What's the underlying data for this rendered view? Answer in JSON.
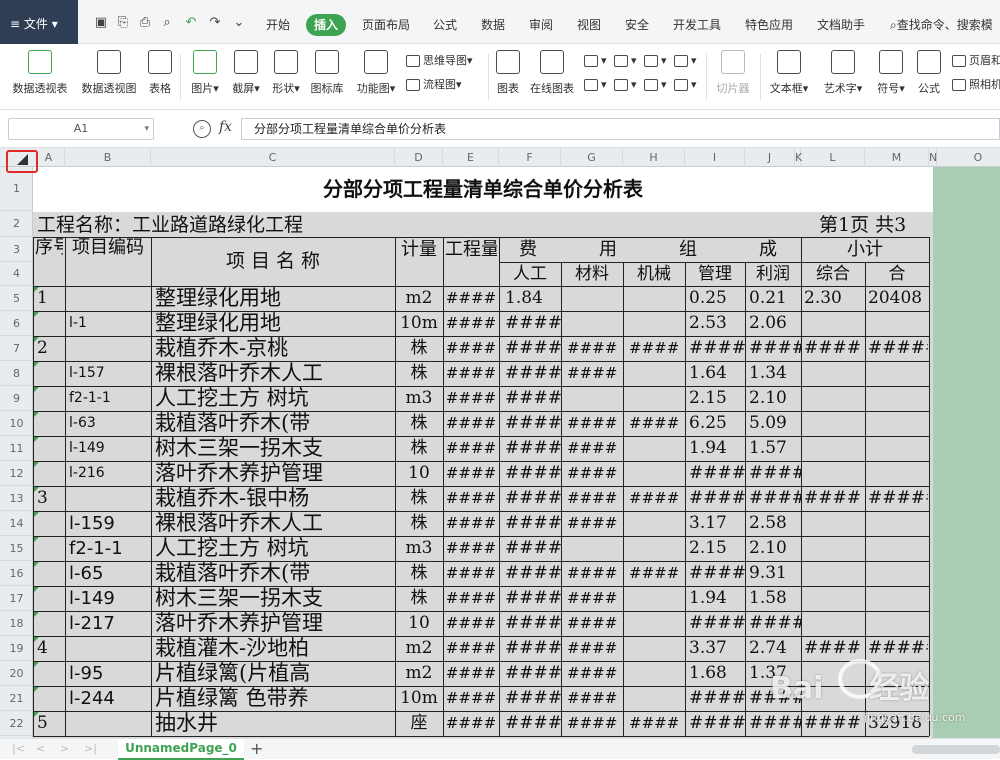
{
  "menubar": {
    "file": "文件",
    "tabs": [
      "开始",
      "插入",
      "页面布局",
      "公式",
      "数据",
      "审阅",
      "视图",
      "安全",
      "开发工具",
      "特色应用",
      "文档助手"
    ],
    "active_tab": "插入",
    "search": "查找命令、搜索模"
  },
  "ribbon": {
    "pivot_table": "数据透视表",
    "pivot_chart": "数据透视图",
    "table": "表格",
    "picture": "图片",
    "screenshot": "截屏",
    "shape": "形状",
    "icon_lib": "图标库",
    "func_chart": "功能图",
    "mindmap": "思维导图",
    "flowchart": "流程图",
    "chart": "图表",
    "online_chart": "在线图表",
    "slicer": "切片器",
    "textbox": "文本框",
    "wordart": "艺术字",
    "symbol": "符号",
    "formula": "公式",
    "header_footer": "页眉和",
    "camera": "照相机"
  },
  "formula_bar": {
    "name_box": "A1",
    "fx": "fx",
    "content": "分部分项工程量清单综合单价分析表"
  },
  "columns": [
    "A",
    "B",
    "C",
    "D",
    "E",
    "F",
    "G",
    "H",
    "I",
    "J",
    "K",
    "L",
    "M",
    "N",
    "O"
  ],
  "rows": [
    "1",
    "2",
    "3",
    "4",
    "5",
    "6",
    "7",
    "8",
    "9",
    "10",
    "11",
    "12",
    "13",
    "14",
    "15",
    "16",
    "17",
    "18",
    "19",
    "20",
    "21",
    "22"
  ],
  "sheet": {
    "title": "分部分项工程量清单综合单价分析表",
    "project": "工程名称：工业路道路绿化工程",
    "page": "第1页  共3",
    "headers": {
      "seq": "序号",
      "code": "项目编码",
      "name": "项 目 名 称",
      "unit": "计量",
      "qty": "工程量",
      "cost_group": [
        "费",
        "用",
        "组",
        "成"
      ],
      "labor": "人工",
      "material": "材料",
      "machine": "机械",
      "manage": "管理",
      "profit": "利润",
      "subtotal": "小计",
      "composite": "综合",
      "total": "合"
    },
    "rows": [
      {
        "a": "1",
        "b": "",
        "c": "整理绿化用地",
        "d": "m2",
        "e": "####",
        "f": "1.84",
        "g": "",
        "h": "",
        "i": "0.25",
        "j": "0.21",
        "l": "2.30",
        "m": "20408"
      },
      {
        "a": "",
        "b": "l-1",
        "c": "整理绿化用地",
        "d": "10m",
        "e": "####",
        "f": "####",
        "g": "",
        "h": "",
        "i": "2.53",
        "j": "2.06",
        "l": "",
        "m": ""
      },
      {
        "a": "2",
        "b": "",
        "c": "栽植乔木-京桃",
        "d": "株",
        "e": "####",
        "f": "####",
        "g": "####",
        "h": "####",
        "i": "####",
        "j": "####",
        "l": "####",
        "m": "#####"
      },
      {
        "a": "",
        "b": "l-157",
        "c": "裸根落叶乔木人工",
        "d": "株",
        "e": "####",
        "f": "####",
        "g": "####",
        "h": "",
        "i": "1.64",
        "j": "1.34",
        "l": "",
        "m": ""
      },
      {
        "a": "",
        "b": "f2-1-1",
        "c": "人工挖土方 树坑",
        "d": "m3",
        "e": "####",
        "f": "####",
        "g": "",
        "h": "",
        "i": "2.15",
        "j": "2.10",
        "l": "",
        "m": ""
      },
      {
        "a": "",
        "b": "l-63",
        "c": "栽植落叶乔木(带",
        "d": "株",
        "e": "####",
        "f": "####",
        "g": "####",
        "h": "####",
        "i": "6.25",
        "j": "5.09",
        "l": "",
        "m": ""
      },
      {
        "a": "",
        "b": "l-149",
        "c": "树木三架一拐木支",
        "d": "株",
        "e": "####",
        "f": "####",
        "g": "####",
        "h": "",
        "i": "1.94",
        "j": "1.57",
        "l": "",
        "m": ""
      },
      {
        "a": "",
        "b": "l-216",
        "c": "落叶乔木养护管理",
        "d": "10",
        "e": "####",
        "f": "####",
        "g": "####",
        "h": "",
        "i": "####",
        "j": "####",
        "l": "",
        "m": ""
      },
      {
        "a": "3",
        "b": "",
        "c": "栽植乔木-银中杨",
        "d": "株",
        "e": "####",
        "f": "####",
        "g": "####",
        "h": "####",
        "i": "####",
        "j": "####",
        "l": "####",
        "m": "#####"
      },
      {
        "a": "",
        "b": "l-159",
        "c": "裸根落叶乔木人工",
        "d": "株",
        "e": "####",
        "f": "####",
        "g": "####",
        "h": "",
        "i": "3.17",
        "j": "2.58",
        "l": "",
        "m": ""
      },
      {
        "a": "",
        "b": "f2-1-1",
        "c": "人工挖土方 树坑",
        "d": "m3",
        "e": "####",
        "f": "####",
        "g": "",
        "h": "",
        "i": "2.15",
        "j": "2.10",
        "l": "",
        "m": ""
      },
      {
        "a": "",
        "b": "l-65",
        "c": "栽植落叶乔木(带",
        "d": "株",
        "e": "####",
        "f": "####",
        "g": "####",
        "h": "####",
        "i": "####",
        "j": "9.31",
        "l": "",
        "m": ""
      },
      {
        "a": "",
        "b": "l-149",
        "c": "树木三架一拐木支",
        "d": "株",
        "e": "####",
        "f": "####",
        "g": "####",
        "h": "",
        "i": "1.94",
        "j": "1.58",
        "l": "",
        "m": ""
      },
      {
        "a": "",
        "b": "l-217",
        "c": "落叶乔木养护管理",
        "d": "10",
        "e": "####",
        "f": "####",
        "g": "####",
        "h": "",
        "i": "####",
        "j": "####",
        "l": "",
        "m": ""
      },
      {
        "a": "4",
        "b": "",
        "c": "栽植灌木-沙地柏",
        "d": "m2",
        "e": "####",
        "f": "####",
        "g": "####",
        "h": "",
        "i": "3.37",
        "j": "2.74",
        "l": "####",
        "m": "#####"
      },
      {
        "a": "",
        "b": "l-95",
        "c": "片植绿篱(片植高",
        "d": "m2",
        "e": "####",
        "f": "####",
        "g": "####",
        "h": "",
        "i": "1.68",
        "j": "1.37",
        "l": "",
        "m": ""
      },
      {
        "a": "",
        "b": "l-244",
        "c": "片植绿篱  色带养",
        "d": "10m",
        "e": "####",
        "f": "####",
        "g": "####",
        "h": "",
        "i": "####",
        "j": "####",
        "l": "",
        "m": ""
      },
      {
        "a": "5",
        "b": "",
        "c": "抽水井",
        "d": "座",
        "e": "####",
        "f": "####",
        "g": "####",
        "h": "####",
        "i": "####",
        "j": "####",
        "l": "####",
        "m": "32918"
      }
    ]
  },
  "tabbar": {
    "sheet_name": "UnnamedPage_0",
    "add": "+"
  },
  "watermark": {
    "brand": "Bai",
    "text": "经验",
    "url": "jingyan.baidu.com"
  }
}
